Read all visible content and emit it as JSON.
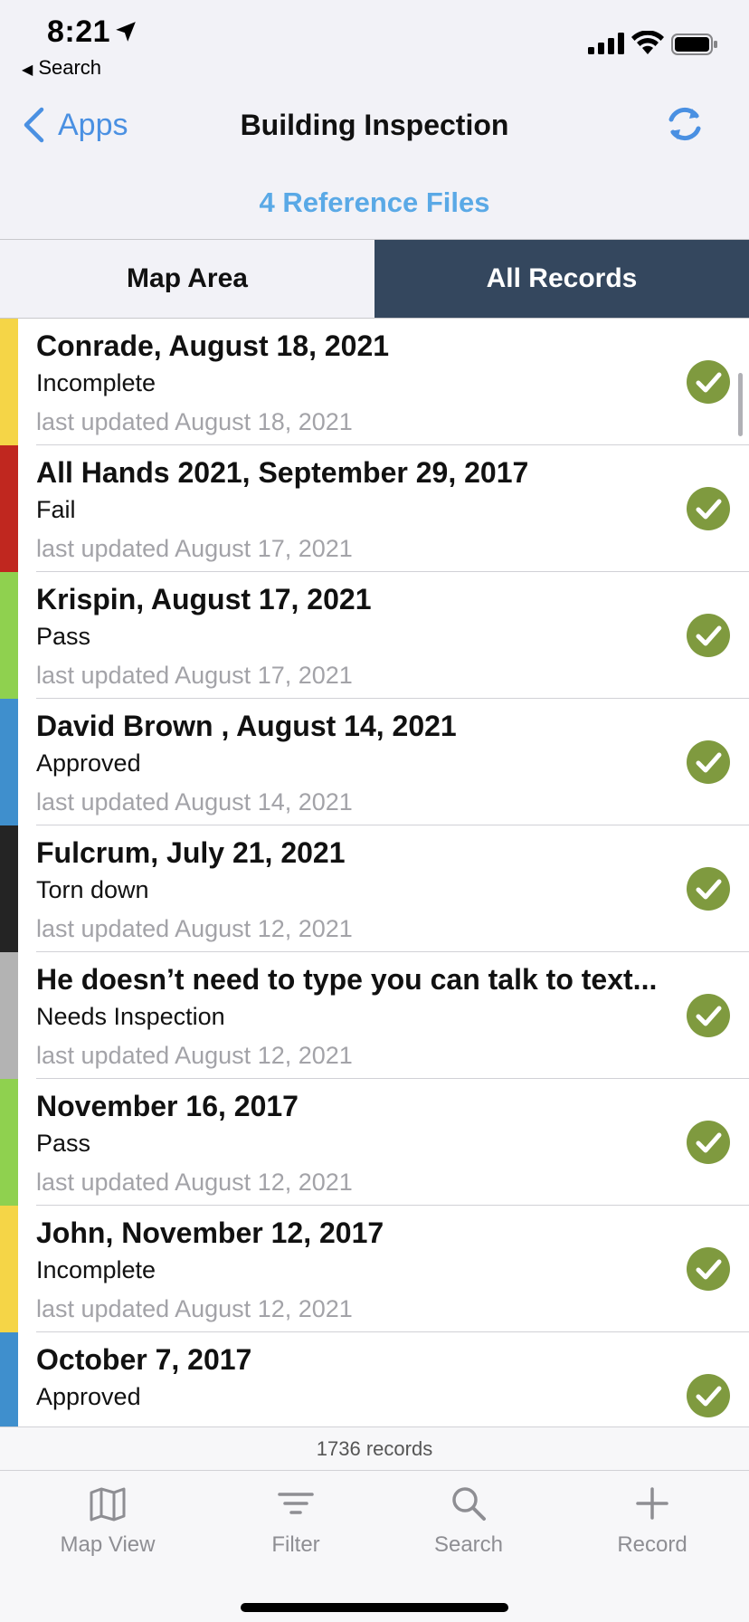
{
  "status_bar": {
    "time": "8:21",
    "back_app": "Search"
  },
  "nav": {
    "back_label": "Apps",
    "title": "Building Inspection",
    "reference_files": "4 Reference Files"
  },
  "tabs": [
    {
      "label": "Map Area",
      "selected": false
    },
    {
      "label": "All Records",
      "selected": true
    }
  ],
  "records": [
    {
      "title": "Conrade, August 18, 2021",
      "status": "Incomplete",
      "updated": "last updated August 18, 2021",
      "color": "#f5d547"
    },
    {
      "title": "All Hands 2021, September 29, 2017",
      "status": "Fail",
      "updated": "last updated August 17, 2021",
      "color": "#c0271f"
    },
    {
      "title": "Krispin, August 17, 2021",
      "status": "Pass",
      "updated": "last updated August 17, 2021",
      "color": "#8fd14f"
    },
    {
      "title": "David Brown , August 14, 2021",
      "status": "Approved",
      "updated": "last updated August 14, 2021",
      "color": "#3f8fcd"
    },
    {
      "title": "Fulcrum, July 21, 2021",
      "status": "Torn down",
      "updated": "last updated August 12, 2021",
      "color": "#242424"
    },
    {
      "title": "He doesn’t need to type you can talk to text...",
      "status": "Needs Inspection",
      "updated": "last updated August 12, 2021",
      "color": "#b3b3b3"
    },
    {
      "title": "November 16, 2017",
      "status": "Pass",
      "updated": "last updated August 12, 2021",
      "color": "#8fd14f"
    },
    {
      "title": "John, November 12, 2017",
      "status": "Incomplete",
      "updated": "last updated August 12, 2021",
      "color": "#f5d547"
    },
    {
      "title": "October 7, 2017",
      "status": "Approved",
      "updated": "",
      "color": "#3f8fcd"
    }
  ],
  "check_color": "#7f9a3f",
  "record_count": "1736 records",
  "tabbar": [
    {
      "label": "Map View",
      "icon": "map-icon"
    },
    {
      "label": "Filter",
      "icon": "filter-icon"
    },
    {
      "label": "Search",
      "icon": "search-icon"
    },
    {
      "label": "Record",
      "icon": "plus-icon"
    }
  ]
}
